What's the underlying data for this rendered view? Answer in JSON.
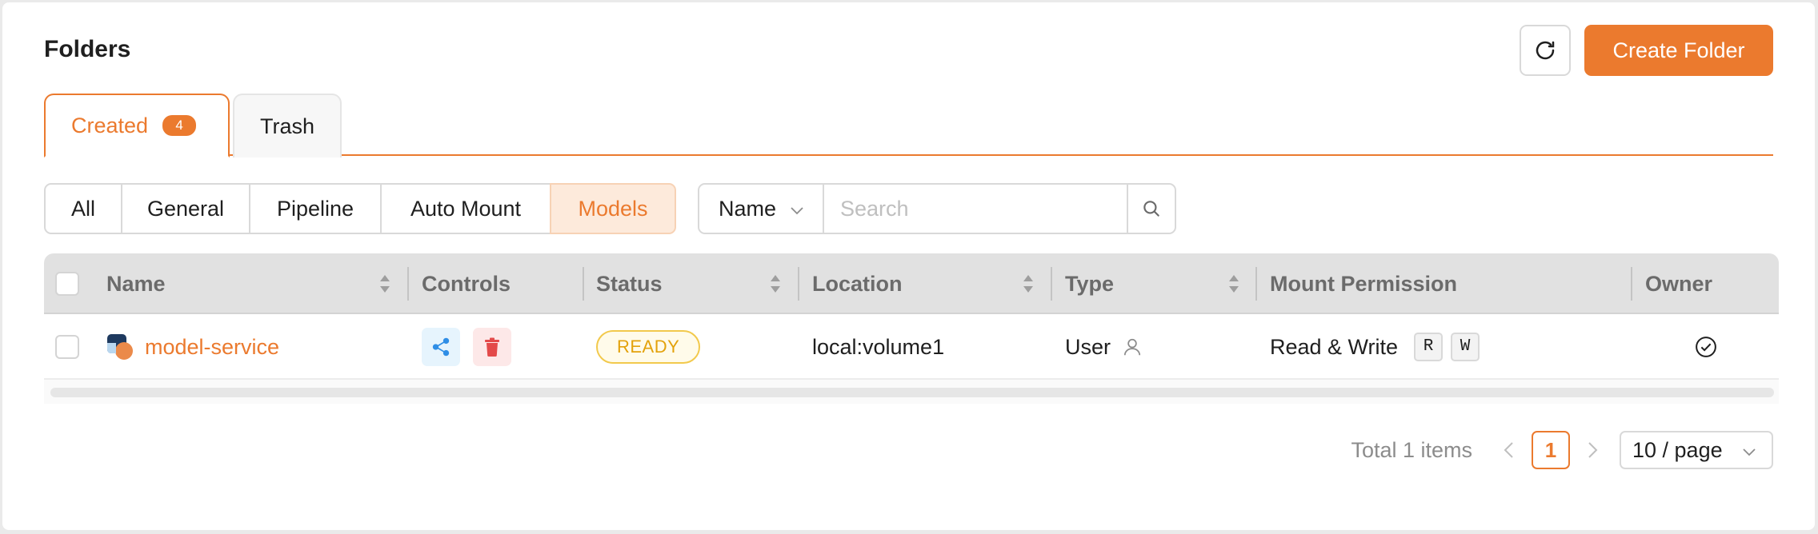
{
  "header": {
    "title": "Folders",
    "create_label": "Create Folder"
  },
  "tabs": [
    {
      "label": "Created",
      "badge": "4",
      "active": true
    },
    {
      "label": "Trash",
      "active": false
    }
  ],
  "filters": {
    "items": [
      "All",
      "General",
      "Pipeline",
      "Auto Mount",
      "Models"
    ],
    "active": "Models"
  },
  "search": {
    "field": "Name",
    "placeholder": "Search"
  },
  "table": {
    "columns": [
      "Name",
      "Controls",
      "Status",
      "Location",
      "Type",
      "Mount Permission",
      "Owner"
    ],
    "rows": [
      {
        "name": "model-service",
        "status": "READY",
        "location": "local:volume1",
        "type": "User",
        "permission": "Read & Write",
        "perm_keys": [
          "R",
          "W"
        ]
      }
    ]
  },
  "pagination": {
    "total": "Total 1 items",
    "current": "1",
    "page_size": "10 / page"
  },
  "colors": {
    "accent": "#eb7a2e",
    "status_ready": "#e3a20b",
    "share": "#2f8ee6",
    "delete": "#e34a4a"
  }
}
